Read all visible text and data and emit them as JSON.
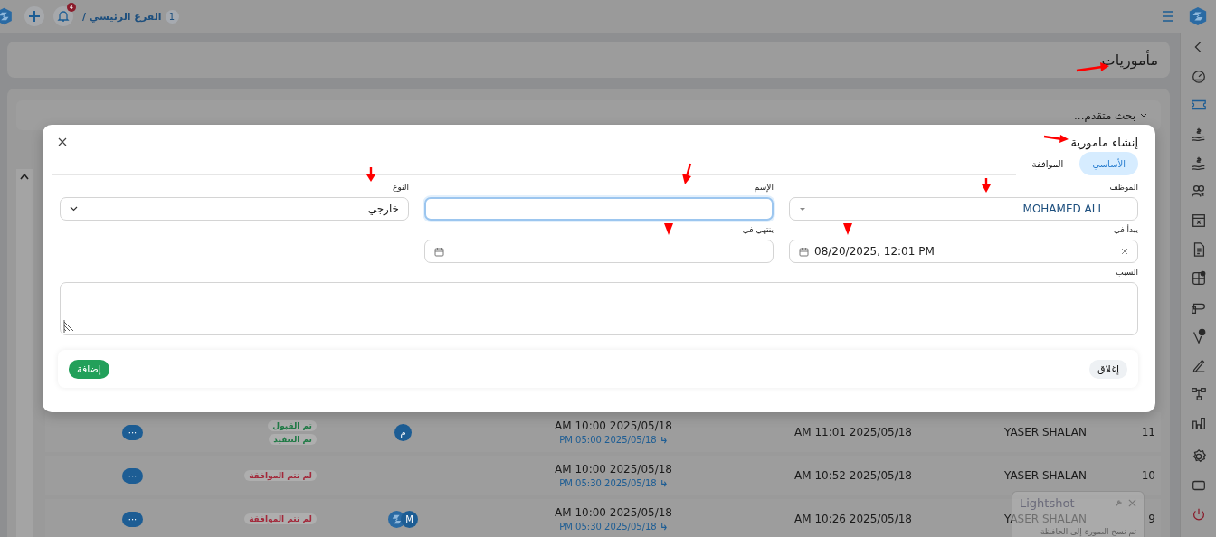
{
  "topbar": {
    "notifications": "4",
    "branch_count": "1",
    "breadcrumb": "الفرع الرئيسي /"
  },
  "sidebar": {
    "items": [
      {
        "selected": false
      },
      {
        "selected": false
      },
      {
        "selected": true
      },
      {
        "selected": false
      },
      {
        "selected": false
      },
      {
        "selected": false
      },
      {
        "selected": false
      },
      {
        "selected": false
      },
      {
        "selected": false
      },
      {
        "selected": false
      },
      {
        "selected": false
      },
      {
        "selected": false
      },
      {
        "selected": false
      },
      {
        "selected": false
      },
      {
        "selected": false
      },
      {
        "selected": false
      },
      {
        "selected": false
      }
    ]
  },
  "page_title": "مأموريات",
  "advanced_search": {
    "label": "بحث متقدم...",
    "expanded": false
  },
  "table": {
    "rows": [
      {
        "number": "11",
        "employee": "YASER SHALAN",
        "created": "AM 11:01 2025/05/18",
        "start": "AM 10:00 2025/05/18",
        "end": "PM 05:00 2025/05/18",
        "avatar": {
          "kind": "letter",
          "text": "م"
        },
        "statuses": [
          {
            "text": "تم القبول",
            "color": "#1f7a45"
          },
          {
            "text": "تم التنفيذ",
            "color": "#1f7a45"
          }
        ],
        "actions": "···"
      },
      {
        "number": "10",
        "employee": "YASER SHALAN",
        "created": "AM 10:52 2025/05/18",
        "start": "AM 10:00 2025/05/18",
        "end": "PM 05:30 2025/05/18",
        "statuses": [
          {
            "text": "لم تتم الموافقة",
            "color": "#a3283a"
          }
        ],
        "actions": "···"
      },
      {
        "number": "9",
        "employee": "YASER SHALAN",
        "created": "AM 10:26 2025/05/18",
        "start": "AM 10:00 2025/05/18",
        "end": "PM 05:30 2025/05/18",
        "avatar": {
          "kind": "pair",
          "text": "M"
        },
        "statuses": [
          {
            "text": "لم تتم الموافقة",
            "color": "#a3283a"
          }
        ],
        "actions": "···"
      }
    ]
  },
  "modal": {
    "title": "إنشاء مامورية",
    "tabs": [
      {
        "label": "الأساسي",
        "selected": true
      },
      {
        "label": "المواففة",
        "selected": false
      }
    ],
    "fields": [
      {
        "kind": "combo",
        "label": "الموظف",
        "value": "MOHAMED ALI",
        "focused": false
      },
      {
        "kind": "text",
        "label": "الإسم",
        "focused": true
      },
      {
        "kind": "select",
        "label": "النوع",
        "value": "خارجي",
        "focused": false
      },
      {
        "kind": "datetime",
        "label": "يبدأ في",
        "value": "08/20/2025, 12:01 PM",
        "focused": false
      },
      {
        "kind": "datetime",
        "label": "ينتهي في",
        "focused": false
      },
      {
        "kind": "textarea",
        "label": "السبب",
        "focused": false
      }
    ],
    "buttons": [
      {
        "kind": "secondary",
        "label": "إغلاق"
      },
      {
        "kind": "primary",
        "label": "إضافة"
      }
    ]
  },
  "toast": {
    "title": "Lightshot",
    "message": "تم نسخ الصورة إلى الحافظة"
  }
}
